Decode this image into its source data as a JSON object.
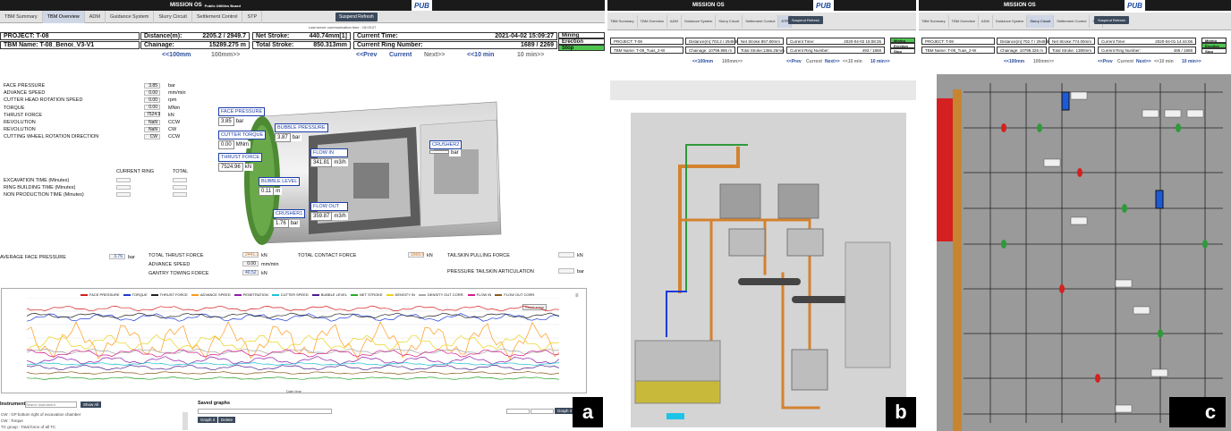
{
  "header": {
    "org_line1": "Public Utilities Board",
    "org_line2": "STARS For DTSS2 Project",
    "brand": "MISSION OS",
    "pub_logo": "PUB",
    "tabs": [
      "TBM Summary",
      "TBM Overview",
      "ADM",
      "Guidance System",
      "Slurry Circuit",
      "Settlement Control",
      "STP"
    ],
    "suspend_button": "Suspend Refresh",
    "comm_label": "Last server communication time : 15:09:27"
  },
  "panel_a": {
    "project": "PROJECT: T-08",
    "tbm_name": "TBM Name: T-08_Benoi_V3-V1",
    "distance_label": "Distance(m):",
    "distance_value": "2205.2 / 2949.7",
    "chainage_label": "Chainage:",
    "chainage_value": "15289.275 m",
    "net_stroke_label": "Net Stroke:",
    "net_stroke_value": "440.74mm[1]",
    "total_stroke_label": "Total Stroke:",
    "total_stroke_value": "850.313mm",
    "current_time_label": "Current Time:",
    "current_time_value": "2021-04-02 15:09:27",
    "ring_label": "Current Ring Number:",
    "ring_value": "1689 / 2269",
    "status": [
      "Mining",
      "Erection",
      "Stop"
    ],
    "nav_left": [
      "<<100mm",
      "100mm>>"
    ],
    "nav_right": [
      "<<Prev",
      "Current",
      "Next>>",
      "<<10 min",
      "10 min>>"
    ],
    "params": [
      {
        "label": "FACE PRESSURE",
        "value": "3.85",
        "unit": "bar"
      },
      {
        "label": "ADVANCE SPEED",
        "value": "0.00",
        "unit": "mm/min"
      },
      {
        "label": "CUTTER HEAD ROTATION SPEED",
        "value": "0.00",
        "unit": "rpm"
      },
      {
        "label": "TORQUE",
        "value": "0.00",
        "unit": "MNm"
      },
      {
        "label": "THRUST FORCE",
        "value": "7524.9",
        "unit": "kN"
      },
      {
        "label": "REVOLUTION",
        "value": "NaN",
        "unit": "CCW"
      },
      {
        "label": "REVOLUTION",
        "value": "NaN",
        "unit": "CW"
      },
      {
        "label": "CUTTING WHEEL ROTATION DIRECTION",
        "value": "CW",
        "unit": "CCW"
      }
    ],
    "time_header_ring": "CURRENT RING",
    "time_header_total": "TOTAL",
    "time_rows": [
      "EXCAVATION TIME (Minutes)",
      "RING BUILDING TIME (Minutes)",
      "NON PRODUCTION TIME (Minutes)"
    ],
    "callouts": {
      "face_pressure": {
        "title": "FACE PRESSURE",
        "value": "3.85",
        "unit": "bar"
      },
      "cutter_torque": {
        "title": "CUTTER TORQUE",
        "value": "0.00",
        "unit": "MNm"
      },
      "thrust_force": {
        "title": "THRUST FORCE",
        "value": "7524.96",
        "unit": "kN"
      },
      "bubble_pressure": {
        "title": "BUBBLE PRESSURE",
        "value": "3.87",
        "unit": "bar"
      },
      "flow_in": {
        "title": "FLOW IN",
        "value": "341.81",
        "unit": "m3/h"
      },
      "bubble_level": {
        "title": "BUBBLE LEVEL",
        "value": "0.11",
        "unit": "m"
      },
      "crusher1": {
        "title": "CRUSHER1",
        "value": "1.76",
        "unit": "bar"
      },
      "flow_out": {
        "title": "FLOW OUT",
        "value": "359.87",
        "unit": "m3/h"
      },
      "crusher2": {
        "title": "CRUSHER2",
        "value": "",
        "unit": "bar"
      }
    },
    "bottom": {
      "avg_face_pressure": "AVERAGE FACE PRESSURE",
      "avg_face_value": "3.76",
      "avg_face_unit": "bar",
      "total_thrust": "TOTAL THRUST FORCE",
      "total_thrust_value": "2441.1",
      "total_thrust_unit": "kN",
      "advance_speed": "ADVANCE SPEED",
      "advance_speed_value": "0.00",
      "advance_speed_unit": "mm/min",
      "gantry": "GANTRY TOWING FORCE",
      "gantry_value": "40.52",
      "gantry_unit": "kN",
      "total_contact": "TOTAL CONTACT FORCE",
      "total_contact_value": "1666.6",
      "total_contact_unit": "kN",
      "tailskin_pulling": "TAILSKIN PULLING FORCE",
      "tailskin_pulling_unit": "kN",
      "pressure_tailskin": "PRESSURE TAILSKIN ARTICULATION",
      "pressure_tailskin_unit": "bar"
    },
    "legend": [
      {
        "name": "FACE PRESSURE",
        "color": "#d61c1c"
      },
      {
        "name": "TORQUE",
        "color": "#1c3ad6"
      },
      {
        "name": "THRUST FORCE",
        "color": "#222222"
      },
      {
        "name": "ADVANCE SPEED",
        "color": "#ff9a1c"
      },
      {
        "name": "PENETRATION",
        "color": "#8b1ca8"
      },
      {
        "name": "CUTTER SPEED",
        "color": "#1cc4d6"
      },
      {
        "name": "BUBBLE LEVEL",
        "color": "#4a1c8a"
      },
      {
        "name": "NET STROKE",
        "color": "#2aa82a"
      },
      {
        "name": "DENSITY IN",
        "color": "#e8d21c"
      },
      {
        "name": "DENSITY OUT CORR.",
        "color": "#a8a8a8"
      },
      {
        "name": "FLOW IN",
        "color": "#d61c8a"
      },
      {
        "name": "FLOW OUT CORR.",
        "color": "#8a5a1c"
      }
    ],
    "reset_zoom": "Reset zoom",
    "x_axis_label": "Date time",
    "instrument_list": "Instrument List",
    "search_placeholder": "Search Instrument",
    "show_all": "Show All",
    "saved_graphs": "Saved graphs",
    "graph_btn": "Graph it",
    "delete_btn": "Delete",
    "list_items": [
      "CW : GP bottom right of excavation chamber",
      "CW : Torque",
      "TC group : Total force of all TC"
    ]
  },
  "panel_b": {
    "project": "PROJECT: T-08",
    "tbm_name": "TBM Name: T-08_Tuas_2-W",
    "distance_label": "Distance(m):",
    "distance_value": "703.2 / 2948.8",
    "chainage_label": "Chainage:",
    "chainage_value": "10799.886 m",
    "net_stroke_label": "Net Stroke:",
    "net_stroke_value": "857.80mm",
    "total_stroke_label": "Total Stroke:",
    "total_stroke_value": "1366.25mm",
    "current_time_label": "Current Time:",
    "current_time_value": "2020-04-02 15:08:25",
    "ring_label": "Current Ring Number:",
    "ring_value": "493 / 1868",
    "status": [
      "Mining",
      "Erection",
      "Stop"
    ]
  },
  "panel_c": {
    "project": "PROJECT: T-08",
    "tbm_name": "TBM Name: T-08_Tuas_2-W",
    "distance_label": "Distance(m):",
    "distance_value": "702.7 / 2948.8",
    "chainage_label": "Chainage:",
    "chainage_value": "10798.326 m",
    "net_stroke_label": "Net Stroke:",
    "net_stroke_value": "774.00mm",
    "total_stroke_label": "Total Stroke:",
    "total_stroke_value": "1380mm",
    "current_time_label": "Current Time:",
    "current_time_value": "2020-04-01 14:44:06",
    "ring_label": "Current Ring Number:",
    "ring_value": "485 / 1868",
    "status": [
      "Mining",
      "Erection",
      "Stop"
    ]
  },
  "badges": [
    "a",
    "b",
    "c"
  ]
}
